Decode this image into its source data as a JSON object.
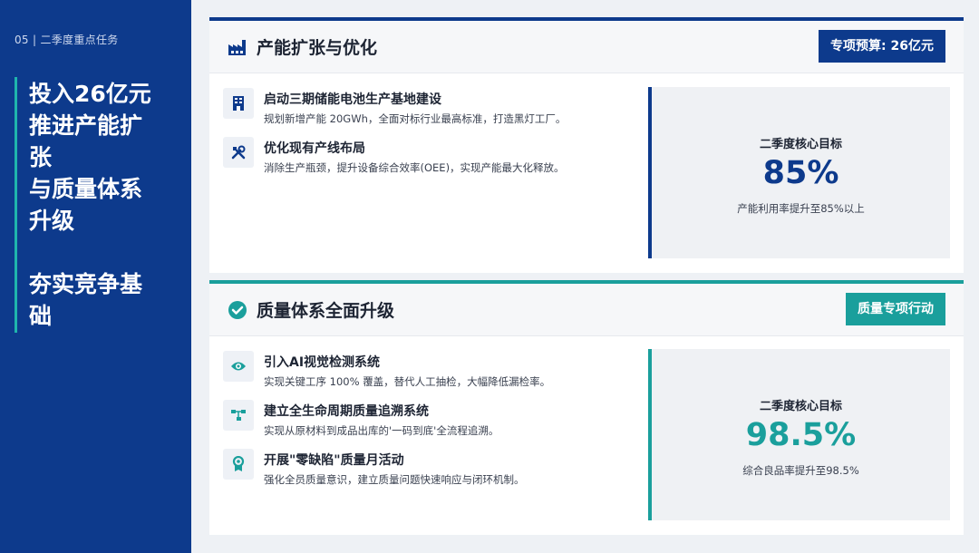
{
  "sidebar": {
    "breadcrumb": "05 | 二季度重点任务",
    "headline_lines": [
      "投入26亿元",
      "推进产能扩",
      "张",
      "与质量体系",
      "升级"
    ],
    "headline_lines_2": [
      "夯实竞争基",
      "础"
    ]
  },
  "section1": {
    "icon": "factory-icon",
    "title": "产能扩张与优化",
    "badge": "专项预算: 26亿元",
    "items": [
      {
        "icon": "building-icon",
        "title": "启动三期储能电池生产基地建设",
        "desc": "规划新增产能 20GWh，全面对标行业最高标准，打造黑灯工厂。"
      },
      {
        "icon": "tools-icon",
        "title": "优化现有产线布局",
        "desc": "消除生产瓶颈，提升设备综合效率(OEE)，实现产能最大化释放。"
      }
    ],
    "goal": {
      "label": "二季度核心目标",
      "value": "85%",
      "sub": "产能利用率提升至85%以上"
    }
  },
  "section2": {
    "icon": "check-circle-icon",
    "title": "质量体系全面升级",
    "badge": "质量专项行动",
    "items": [
      {
        "icon": "eye-icon",
        "title": "引入AI视觉检测系统",
        "desc": "实现关键工序 100% 覆盖，替代人工抽检，大幅降低漏检率。"
      },
      {
        "icon": "network-icon",
        "title": "建立全生命周期质量追溯系统",
        "desc": "实现从原材料到成品出库的'一码到底'全流程追溯。"
      },
      {
        "icon": "award-icon",
        "title": "开展\"零缺陷\"质量月活动",
        "desc": "强化全员质量意识，建立质量问题快速响应与闭环机制。"
      }
    ],
    "goal": {
      "label": "二季度核心目标",
      "value": "98.5%",
      "sub": "综合良品率提升至98.5%"
    }
  },
  "colors": {
    "navy": "#0d3a8c",
    "teal": "#1a9f9c",
    "accent_bar": "#1fb5ad"
  }
}
